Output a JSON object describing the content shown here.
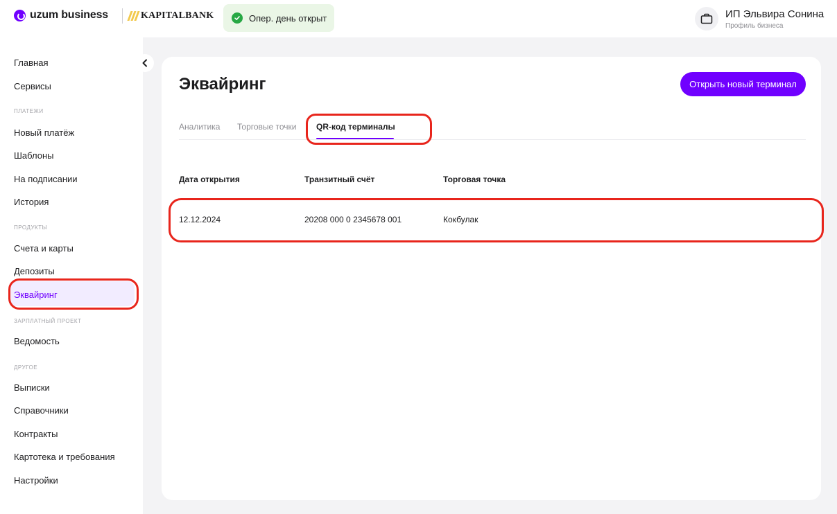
{
  "header": {
    "uzum_logo": "uzum business",
    "kapital_logo": "KAPITALBANK",
    "status": "Опер. день открыт",
    "profile_name": "ИП Эльвира Сонина",
    "profile_sub": "Профиль бизнеса",
    "icons": {
      "uzum": "uzum-logo-icon",
      "kapital": "kapitalbank-logo-icon",
      "status": "check-circle-icon",
      "profile": "briefcase-icon"
    }
  },
  "sidebar": {
    "collapse_icon": "chevron-left-icon",
    "items": [
      {
        "label": "Главная"
      },
      {
        "label": "Сервисы"
      }
    ],
    "sections": {
      "payments": "ПЛАТЕЖИ",
      "products": "ПРОДУКТЫ",
      "salary": "ЗАРПЛАТНЫЙ ПРОЕКТ",
      "other": "ДРУГОЕ"
    },
    "payments_items": [
      {
        "label": "Новый платёж"
      },
      {
        "label": "Шаблоны"
      },
      {
        "label": "На подписании"
      },
      {
        "label": "История"
      }
    ],
    "products_items": [
      {
        "label": "Счета и карты"
      },
      {
        "label": "Депозиты"
      },
      {
        "label": "Эквайринг"
      }
    ],
    "salary_items": [
      {
        "label": "Ведомость"
      }
    ],
    "other_items": [
      {
        "label": "Выписки"
      },
      {
        "label": "Справочники"
      },
      {
        "label": "Контракты"
      },
      {
        "label": "Картотека и требования"
      },
      {
        "label": "Настройки"
      }
    ],
    "active": "Эквайринг",
    "active_color": "#7000ff"
  },
  "main": {
    "title": "Эквайринг",
    "primary_button": "Открыть новый терминал",
    "tabs": [
      {
        "label": "Аналитика"
      },
      {
        "label": "Торговые точки"
      },
      {
        "label": "QR-код терминалы"
      }
    ],
    "active_tab": "QR-код терминалы",
    "table": {
      "columns": [
        "Дата открытия",
        "Транзитный счёт",
        "Торговая точка"
      ],
      "rows": [
        [
          "12.12.2024",
          "20208 000 0 2345678 001",
          "Кокбулак"
        ]
      ]
    }
  },
  "colors": {
    "accent": "#7000ff",
    "highlight": "#e8251c",
    "status_bg": "#eaf6e6",
    "status_check": "#27a844"
  }
}
